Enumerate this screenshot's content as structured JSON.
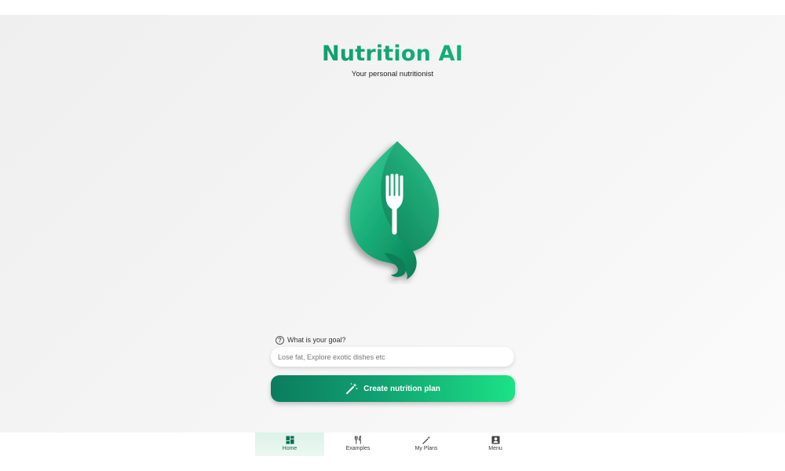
{
  "header": {
    "title": "Nutrition AI",
    "subtitle": "Your personal nutritionist"
  },
  "logo": {
    "icon": "leaf-fork-logo-icon",
    "color": "#12a877"
  },
  "goal": {
    "label": "What is your goal?",
    "help_icon": "question-circle-icon",
    "input_value": "",
    "placeholder": "Lose fat, Explore exotic dishes etc"
  },
  "create_button": {
    "label": "Create nutrition plan",
    "icon": "magic-wand-icon"
  },
  "nav": {
    "items": [
      {
        "label": "Home",
        "icon": "dashboard-icon",
        "active": true
      },
      {
        "label": "Examples",
        "icon": "fork-knife-icon",
        "active": false
      },
      {
        "label": "My Plans",
        "icon": "magic-wand-icon",
        "active": false
      },
      {
        "label": "Menu",
        "icon": "account-box-icon",
        "active": false
      }
    ]
  },
  "colors": {
    "brand_green": "#0f8e66",
    "accent_green": "#1ce286",
    "active_nav_bg": "#dcf3ea"
  }
}
